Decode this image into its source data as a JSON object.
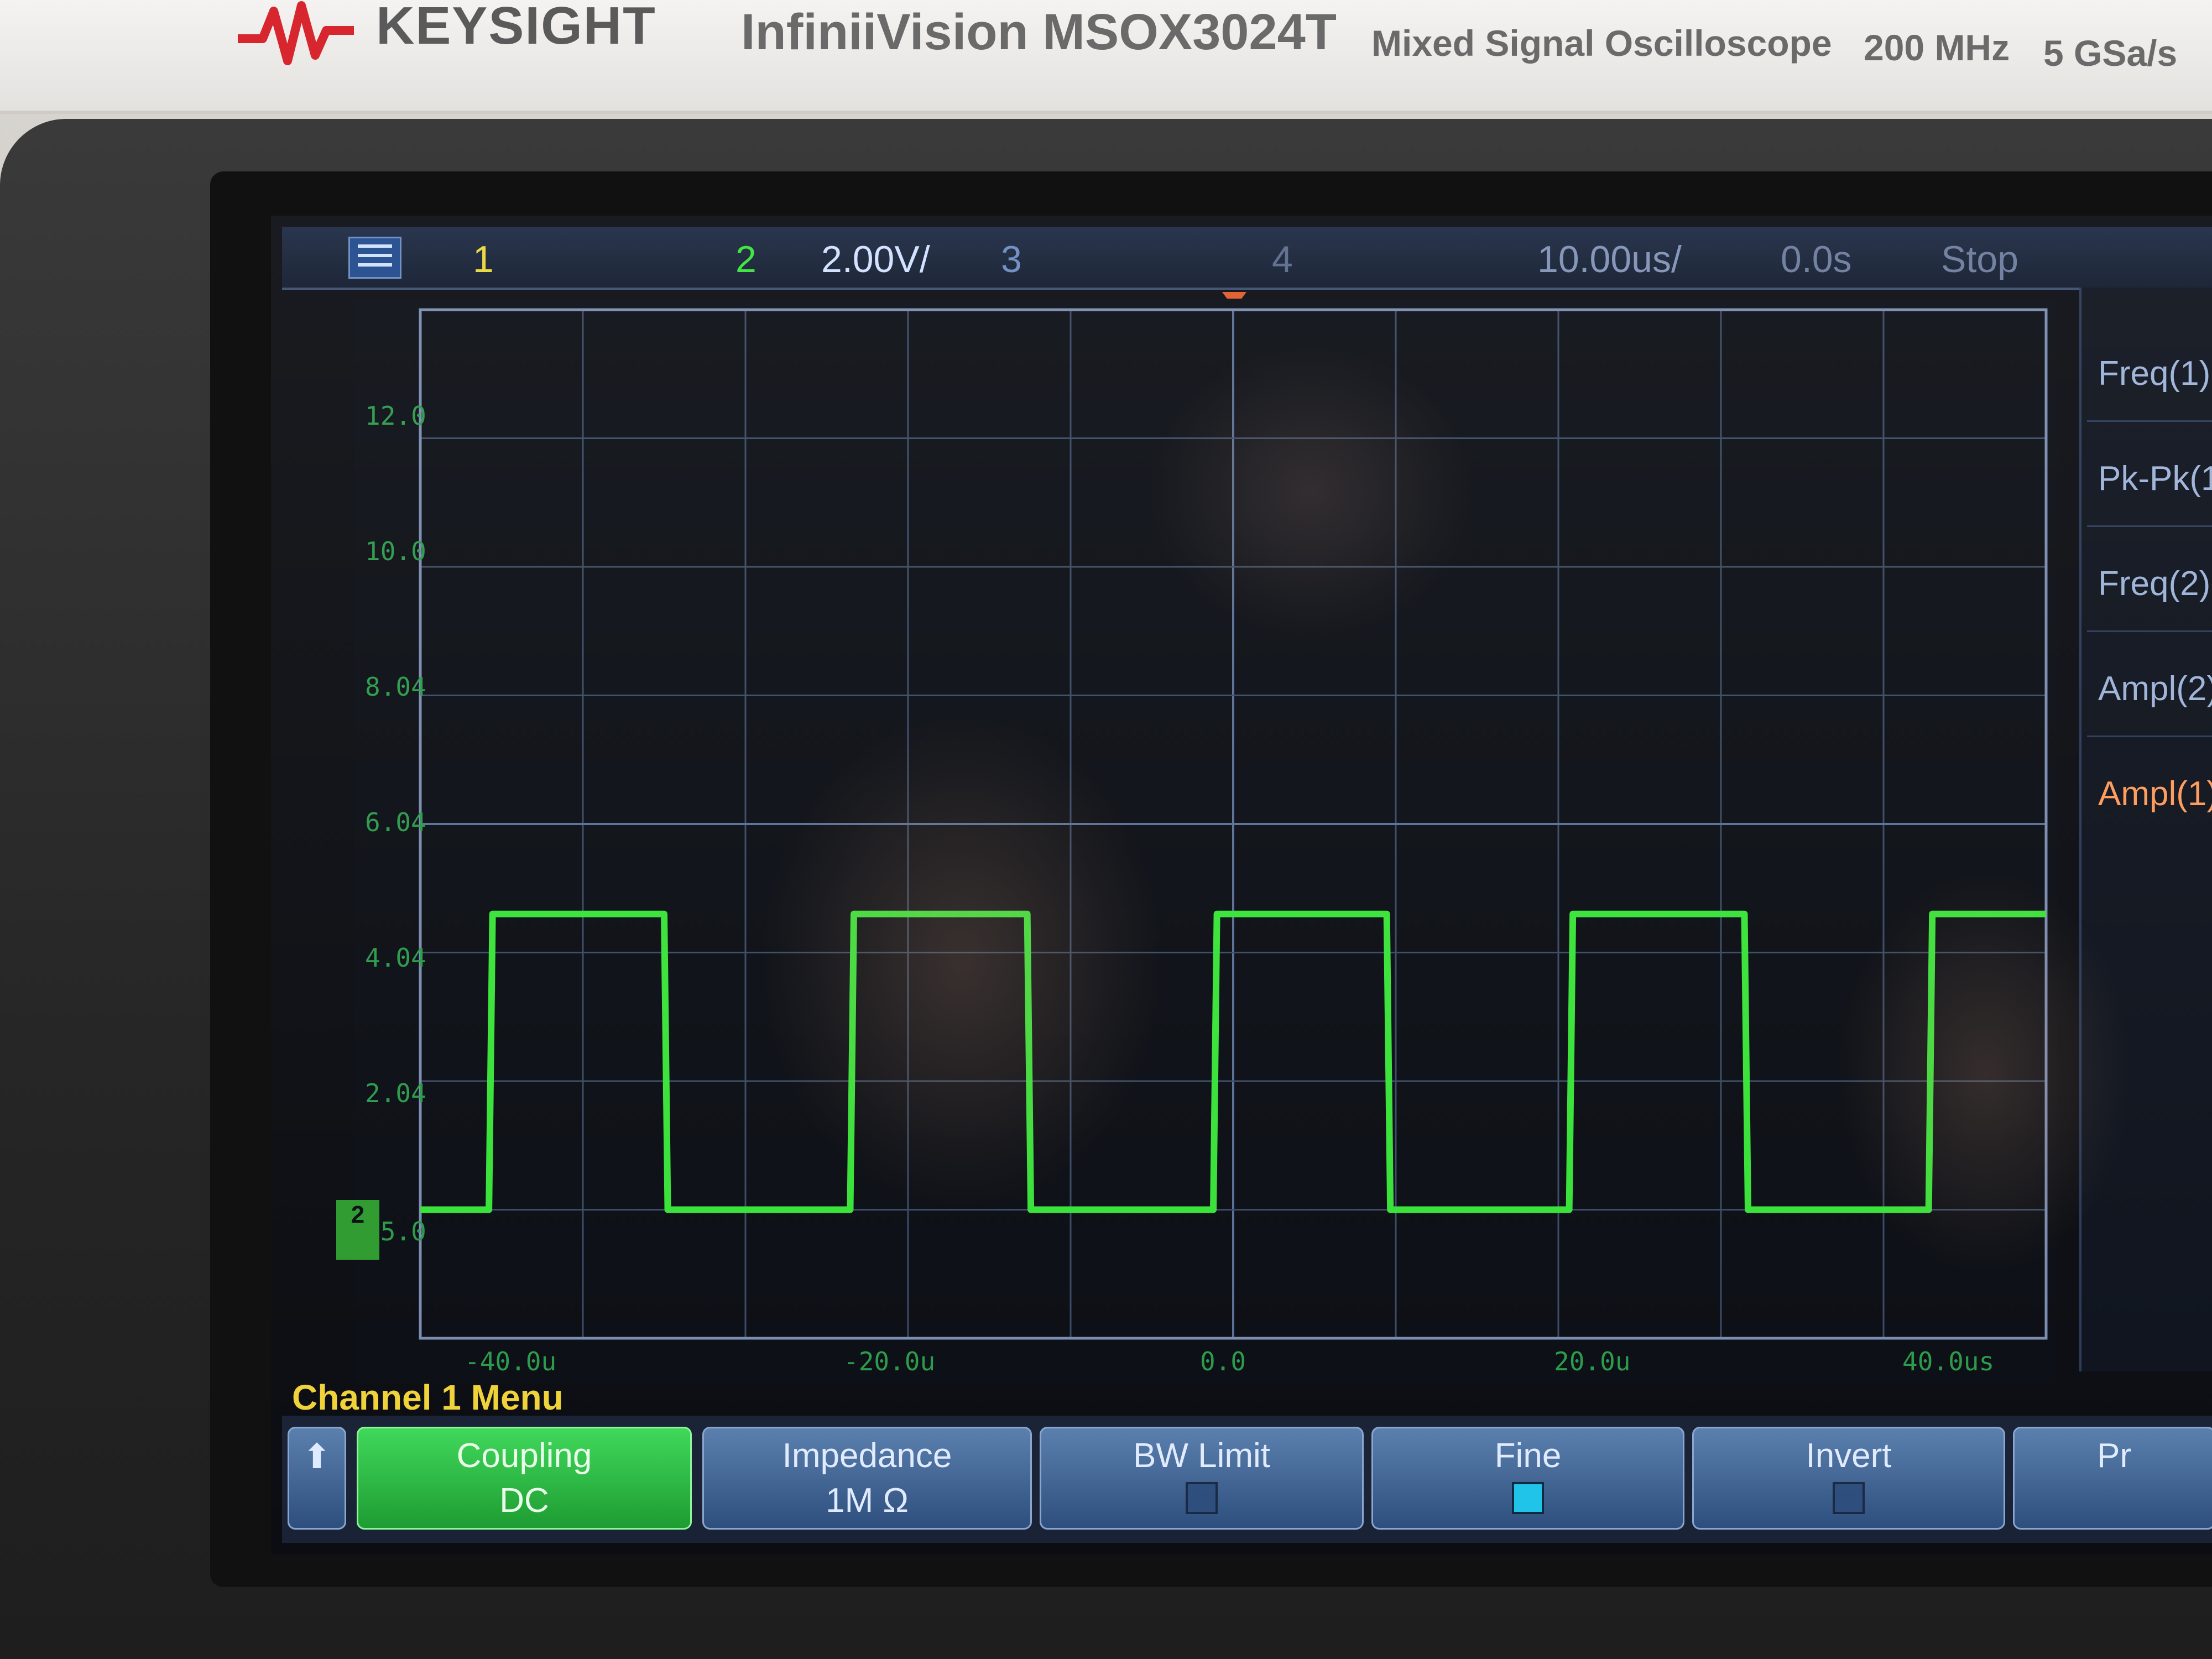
{
  "instrument": {
    "brand": "KEYSIGHT",
    "model": "InfiniiVision MSOX3024T",
    "description": "Mixed Signal Oscilloscope",
    "bandwidth": "200 MHz",
    "sample_rate": "5 GSa/s",
    "logo_color": "#d7262e"
  },
  "status_bar": {
    "ch1": "1",
    "ch2": "2",
    "ch2_scale": "2.00V/",
    "ch3": "3",
    "ch4": "4",
    "timebase": "10.00us/",
    "delay": "0.0s",
    "run_state": "Stop"
  },
  "voltage_labels": [
    "12.0",
    "10.0",
    "8.04",
    "6.04",
    "4.04",
    "2.04",
    "05.0"
  ],
  "time_labels": [
    "-40.0u",
    "-20.0u",
    "0.0",
    "20.0u",
    "40.0us"
  ],
  "ground_marker": "2",
  "measurements": [
    "Freq(1):",
    "Pk-Pk(1",
    "Freq(2):",
    "Ampl(2):",
    "Ampl(1):"
  ],
  "channel_menu": {
    "title": "Channel 1 Menu",
    "coupling_label": "Coupling",
    "coupling_value": "DC",
    "impedance_label": "Impedance",
    "impedance_value": "1M Ω",
    "bw_limit_label": "BW Limit",
    "bw_limit_checked": false,
    "fine_label": "Fine",
    "fine_checked": true,
    "invert_label": "Invert",
    "invert_checked": false,
    "probe_label": "Pr"
  },
  "chart_data": {
    "type": "line",
    "series": [
      {
        "name": "2",
        "color": "#39e239",
        "x": [
          -45,
          -41.2,
          -41.0,
          -31.5,
          -31.3,
          -21.2,
          -21.0,
          -11.4,
          -11.2,
          -1.1,
          -0.9,
          8.5,
          8.7,
          18.6,
          18.8,
          28.3,
          28.5,
          38.5,
          38.7,
          45
        ],
        "values": [
          0,
          0,
          4.6,
          4.6,
          0,
          0,
          4.6,
          4.6,
          0,
          0,
          4.6,
          4.6,
          0,
          0,
          4.6,
          4.6,
          0,
          0,
          4.6,
          4.6
        ]
      }
    ],
    "xlabel": "",
    "ylabel": "",
    "xlim": [
      -45,
      45
    ],
    "ylim": [
      -2,
      14
    ],
    "grid": true
  }
}
